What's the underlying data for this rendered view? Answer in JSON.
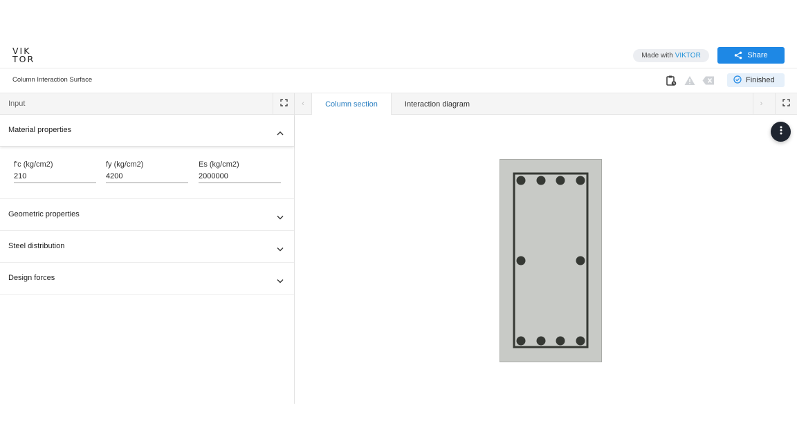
{
  "header": {
    "logo_line1": "VIK",
    "logo_line2": "TOR",
    "made_with_prefix": "Made with",
    "made_with_brand": "VIKTOR",
    "share_label": "Share"
  },
  "app": {
    "title": "Column Interaction Surface",
    "status": "Finished"
  },
  "input_panel": {
    "title": "Input",
    "sections": [
      {
        "title": "Material properties",
        "expanded": true
      },
      {
        "title": "Geometric properties",
        "expanded": false
      },
      {
        "title": "Steel distribution",
        "expanded": false
      },
      {
        "title": "Design forces",
        "expanded": false
      }
    ],
    "material_fields": [
      {
        "label": "f'c (kg/cm2)",
        "value": "210"
      },
      {
        "label": "fy (kg/cm2)",
        "value": "4200"
      },
      {
        "label": "Es (kg/cm2)",
        "value": "2000000"
      }
    ]
  },
  "view_panel": {
    "tabs": [
      {
        "label": "Column section",
        "active": true
      },
      {
        "label": "Interaction diagram",
        "active": false
      }
    ],
    "prev_arrow": "‹",
    "next_arrow": "›"
  },
  "colors": {
    "accent": "#1e88e5",
    "active_tab_text": "#2a7fc1",
    "concrete_fill": "#c8cac6",
    "rebar": "#363934",
    "status_bg": "#e6f0fa"
  }
}
